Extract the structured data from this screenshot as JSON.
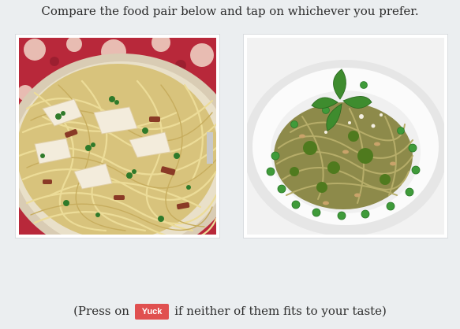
{
  "prompt": {
    "instruction": "Compare the food pair below and tap on whichever you prefer."
  },
  "choices": [
    {
      "icon": "spaghetti-chicken-bacon-photo"
    },
    {
      "icon": "spaghetti-pesto-peas-photo"
    }
  ],
  "footer": {
    "prefix": "(Press on",
    "yuck_label": "Yuck",
    "suffix": "if neither of them fits to your taste)"
  },
  "colors": {
    "background": "#ebeef0",
    "yuck_button": "#e05050"
  }
}
